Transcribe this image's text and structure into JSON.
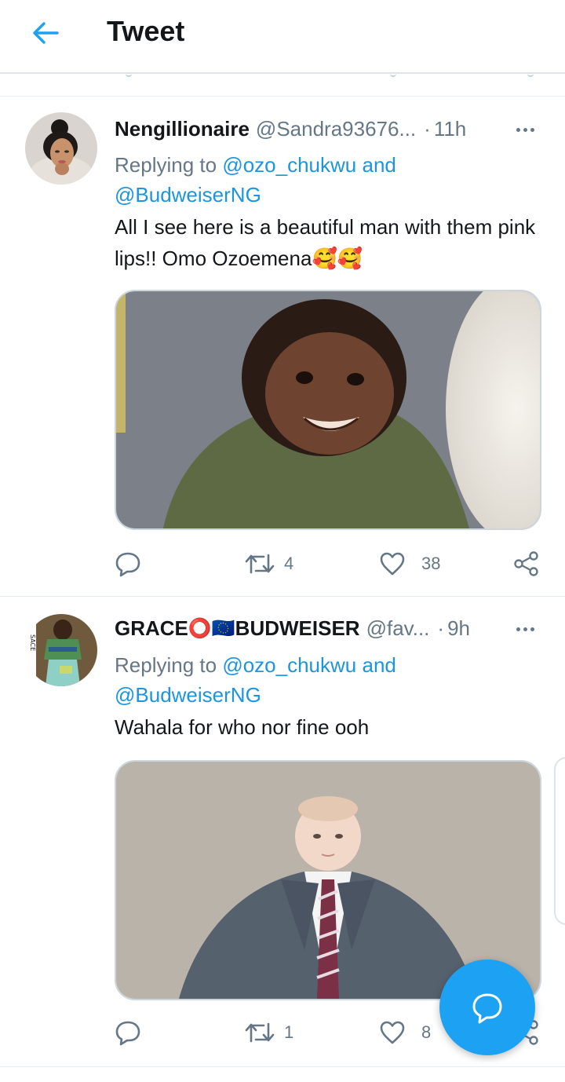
{
  "header": {
    "title": "Tweet"
  },
  "tweets": [
    {
      "name": "Nengillionaire",
      "handle": "@Sandra93676...",
      "separator": "·",
      "time": "11h",
      "replying_prefix": "Replying to",
      "mention1": "@ozo_chukwu",
      "conjunction": "and",
      "mention2": "@BudweiserNG",
      "text": "All I see here is a beautiful man with them pink lips!! Omo Ozoemena",
      "emoji": "🥰🥰",
      "replies": "",
      "retweets": "4",
      "likes": "38"
    },
    {
      "name": "GRACE",
      "flag_emoji": "⭕🇪🇺",
      "name_suffix": "BUDWEISER",
      "handle": "@fav...",
      "separator": "·",
      "time": "9h",
      "replying_prefix": "Replying to",
      "mention1": "@ozo_chukwu",
      "conjunction": "and",
      "mention2": "@BudweiserNG",
      "text": "Wahala for who nor fine ooh",
      "replies": "",
      "retweets": "1",
      "likes": "8"
    }
  ],
  "icons": {
    "back": "arrow-left-icon",
    "more": "more-horizontal-icon",
    "reply": "comment-bubble-icon",
    "retweet": "retweet-icon",
    "like": "heart-icon",
    "share": "share-icon",
    "compose": "compose-reply-icon"
  },
  "colors": {
    "accent": "#1da1f2",
    "link": "#1b95e0",
    "secondary_text": "#657786",
    "primary_text": "#14171a",
    "divider": "#e6ecf0"
  }
}
